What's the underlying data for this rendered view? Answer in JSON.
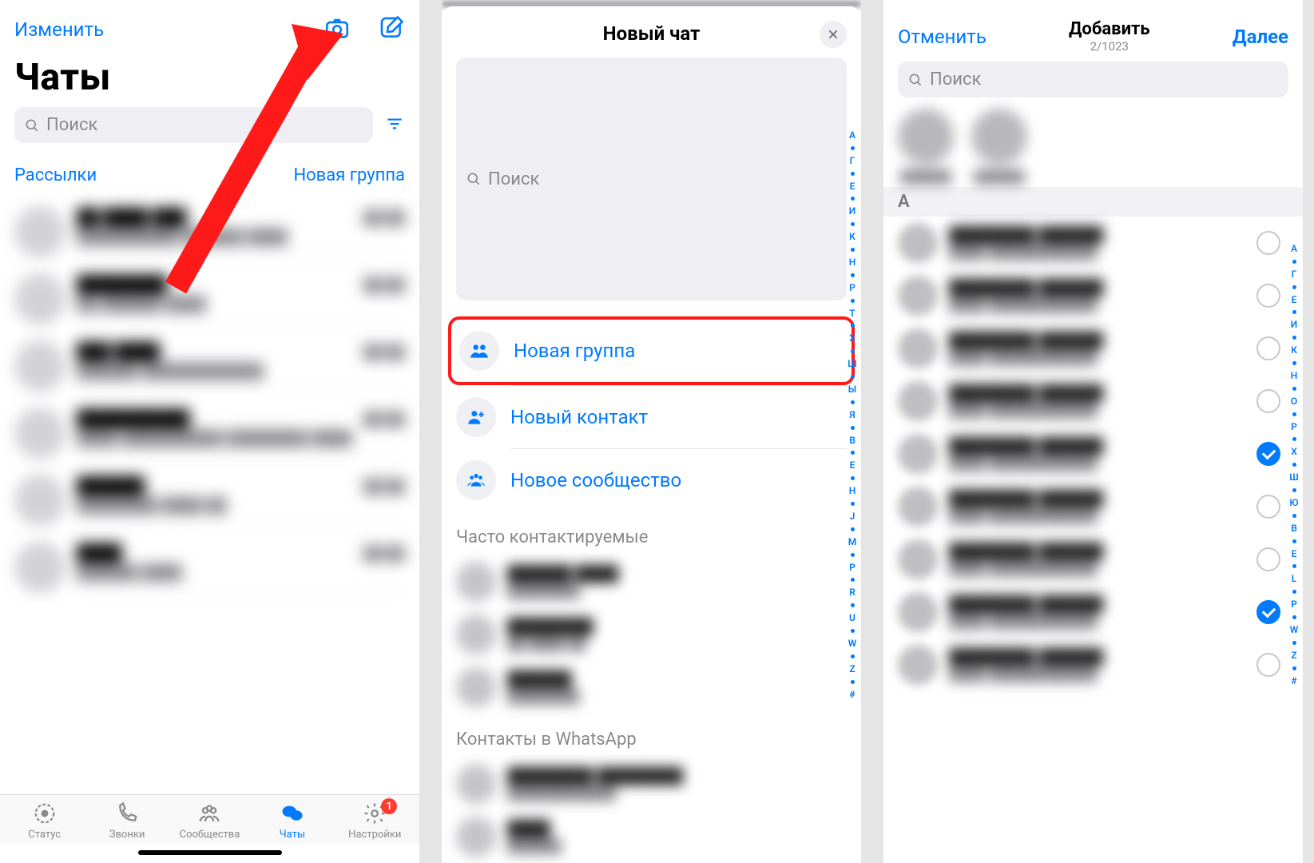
{
  "screen1": {
    "edit_label": "Изменить",
    "title": "Чаты",
    "search_placeholder": "Поиск",
    "link_broadcasts": "Рассылки",
    "link_new_group": "Новая группа",
    "tabs": {
      "status": "Статус",
      "calls": "Звонки",
      "communities": "Сообщества",
      "chats": "Чаты",
      "settings": "Настройки",
      "settings_badge": "1"
    }
  },
  "screen2": {
    "title": "Новый чат",
    "search_placeholder": "Поиск",
    "action_new_group": "Новая группа",
    "action_new_contact": "Новый контакт",
    "action_new_community": "Новое сообщество",
    "section_frequent": "Часто контактируемые",
    "section_contacts": "Контакты в WhatsApp",
    "index_letters": [
      "А",
      "Г",
      "Е",
      "И",
      "К",
      "Н",
      "Р",
      "Т",
      "Х",
      "Ш",
      "Ы",
      "Я",
      "В",
      "E",
      "H",
      "J",
      "M",
      "P",
      "R",
      "U",
      "W",
      "Z",
      "#"
    ]
  },
  "screen3": {
    "cancel_label": "Отменить",
    "title": "Добавить",
    "count": "2/1023",
    "next_label": "Далее",
    "search_placeholder": "Поиск",
    "letter_header": "А",
    "contacts": [
      {
        "checked": false
      },
      {
        "checked": false
      },
      {
        "checked": false
      },
      {
        "checked": false
      },
      {
        "checked": true
      },
      {
        "checked": false
      },
      {
        "checked": false
      },
      {
        "checked": true
      },
      {
        "checked": false
      }
    ],
    "index_letters": [
      "А",
      "Г",
      "Е",
      "И",
      "К",
      "Н",
      "О",
      "Р",
      "Х",
      "Ш",
      "Ю",
      "B",
      "E",
      "L",
      "P",
      "W",
      "Z",
      "#"
    ]
  }
}
